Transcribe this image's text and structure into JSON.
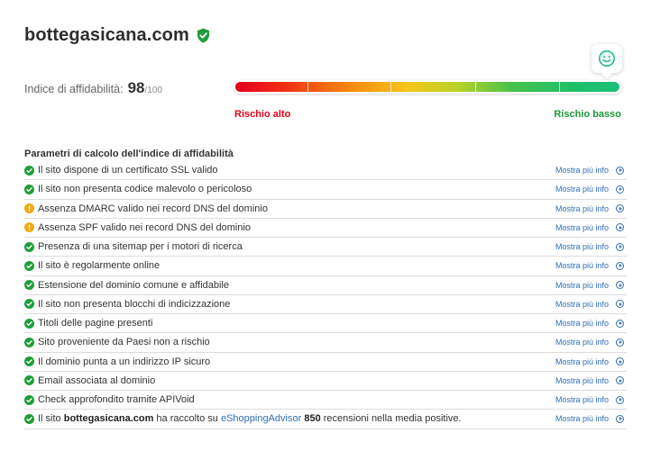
{
  "site": {
    "name": "bottegasicana.com"
  },
  "score": {
    "label": "Indice di affidabilità:",
    "value": "98",
    "max": "/100",
    "fraction": 0.98
  },
  "meter": {
    "risk_high": "Rischio alto",
    "risk_low": "Rischio basso"
  },
  "params": {
    "title": "Parametri di calcolo dell'indice di affidabilità",
    "more_label": "Mostra più info",
    "items": [
      {
        "status": "ok",
        "text": "Il sito dispone di un certificato SSL valido"
      },
      {
        "status": "ok",
        "text": "Il sito non presenta codice malevolo o pericoloso"
      },
      {
        "status": "warn",
        "text": "Assenza DMARC valido nei record DNS del dominio"
      },
      {
        "status": "warn",
        "text": "Assenza SPF valido nei record DNS del dominio"
      },
      {
        "status": "ok",
        "text": "Presenza di una sitemap per i motori di ricerca"
      },
      {
        "status": "ok",
        "text": "Il sito è regolarmente online"
      },
      {
        "status": "ok",
        "text": "Estensione del dominio comune e affidabile"
      },
      {
        "status": "ok",
        "text": "Il sito non presenta blocchi di indicizzazione"
      },
      {
        "status": "ok",
        "text": "Titoli delle pagine presenti"
      },
      {
        "status": "ok",
        "text": "Sito proveniente da Paesi non a rischio"
      },
      {
        "status": "ok",
        "text": "Il dominio punta a un indirizzo IP sicuro"
      },
      {
        "status": "ok",
        "text": "Email associata al dominio"
      },
      {
        "status": "ok",
        "text": "Check approfondito tramite APIVoid"
      },
      {
        "status": "ok",
        "parts": [
          {
            "t": "Il sito ",
            "style": "normal"
          },
          {
            "t": "bottegasicana.com",
            "style": "bold"
          },
          {
            "t": " ha raccolto su ",
            "style": "normal"
          },
          {
            "t": "eShoppingAdvisor",
            "style": "link"
          },
          {
            "t": " ",
            "style": "normal"
          },
          {
            "t": "850",
            "style": "bold"
          },
          {
            "t": " recensioni nella media positive.",
            "style": "normal"
          }
        ]
      }
    ]
  },
  "colors": {
    "ok": "#1f9d3a",
    "warn": "#f3a712",
    "risk_high": "#e3001b",
    "risk_low": "#1e9a38",
    "link": "#2f6fb7"
  },
  "icons": {
    "verified": "shield-check-icon",
    "smiley": "smiley-face-icon",
    "ok": "check-circle-icon",
    "warn": "warning-circle-icon",
    "more": "arrow-circle-right-icon"
  }
}
